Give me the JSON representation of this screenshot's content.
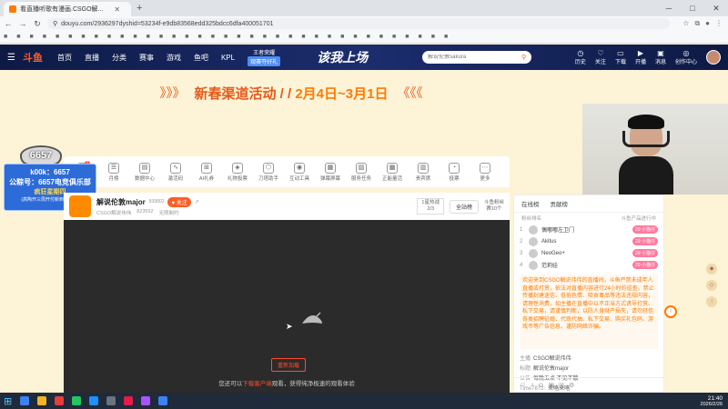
{
  "browser": {
    "tab_title": "看直播听歌有漫画.CSGO解...",
    "url": "douyu.com/2936297dyshid=53234f-e9db83568edd325bdcc6dfa400051701",
    "bookmarks": [
      "■",
      "■",
      "■",
      "■",
      "■",
      "■",
      "■",
      "■",
      "■",
      "■",
      "■",
      "■",
      "■",
      "■",
      "■",
      "■",
      "■",
      "■",
      "■",
      "■",
      "■",
      "■",
      "■",
      "■",
      "■",
      "■",
      "■",
      "■",
      "■",
      "■",
      "■",
      "■",
      "■",
      "■",
      "■"
    ]
  },
  "header": {
    "logo": "斗鱼",
    "nav": [
      "首页",
      "直播",
      "分类",
      "赛事",
      "游戏",
      "鱼吧",
      "KPL"
    ],
    "kpl_top": "王者荣耀",
    "kpl_badge": "观赛夺好礼",
    "slogan": "该我上场",
    "search_placeholder": "解说伦敦sakura",
    "icons": [
      {
        "glyph": "◷",
        "label": "历史"
      },
      {
        "glyph": "♡",
        "label": "关注"
      },
      {
        "glyph": "▭",
        "label": "下载"
      },
      {
        "glyph": "▶",
        "label": "开播"
      },
      {
        "glyph": "▣",
        "label": "消息"
      },
      {
        "glyph": "◎",
        "label": "创作中心"
      }
    ]
  },
  "banner": {
    "left_arrows": "》》》",
    "text": "新春渠道活动 / / ",
    "dates": "2月4日~3月1日",
    "right_arrows": "《《《"
  },
  "overlay": {
    "badge": "6657",
    "line1": "k00k：6657",
    "line2": "公粽号：6657电竞俱乐部",
    "line3": "疯狂星期四",
    "line4": "(高陶开三周开付新到和刚开)"
  },
  "toolbar": [
    {
      "glyph": "◆",
      "label": "直播开关",
      "badge": "1"
    },
    {
      "glyph": "☰",
      "label": "月榜"
    },
    {
      "glyph": "▤",
      "label": "数据中心"
    },
    {
      "glyph": "∿",
      "label": "激活码"
    },
    {
      "glyph": "⊞",
      "label": "AI礼券"
    },
    {
      "glyph": "◈",
      "label": "礼物投票"
    },
    {
      "glyph": "⬡",
      "label": "刀塔助手"
    },
    {
      "glyph": "◉",
      "label": "互动工具"
    },
    {
      "glyph": "▦",
      "label": "弹幕屏幕"
    },
    {
      "glyph": "▨",
      "label": "服务任务"
    },
    {
      "glyph": "▩",
      "label": "正能量活"
    },
    {
      "glyph": "▥",
      "label": "贵宾席"
    },
    {
      "glyph": "◔",
      "label": "投票"
    },
    {
      "glyph": "⋯",
      "label": "更多"
    }
  ],
  "streamer": {
    "name": "解说伦敦major",
    "id": "839802",
    "follow_label": "关注",
    "category": "CSGO解说伟伟",
    "viewers": "823552",
    "status": "无限制约",
    "rank_label": "1星热战",
    "rank_value": "2/3",
    "all_label": "全站榜",
    "fans_label": "斗鱼粉丝",
    "fans_value": "赛10个"
  },
  "video": {
    "play_label": "重新加载",
    "hint_prefix": "您还可以",
    "hint_link": "下载客户端",
    "hint_suffix": "观看，获得纯净极速的观看体验"
  },
  "rpanel": {
    "tabs": [
      "在线榜",
      "贡献榜"
    ],
    "sub_left": "粉丝排名",
    "sub_right": "斗鱼产品进行中",
    "ranks": [
      {
        "num": "1",
        "name": "偶嘟嘟左卫门",
        "tag": "29 小猫仔"
      },
      {
        "num": "2",
        "name": "Akitus",
        "tag": "29 小猫仔"
      },
      {
        "num": "3",
        "name": "NeoGeo+",
        "tag": "29 小猫仔"
      },
      {
        "num": "4",
        "name": "范莉娃",
        "tag": "29 小猫仔"
      }
    ],
    "notice": "欢迎来到CSGO解说伟伟的直播间，斗鱼严禁未成年人直播或打赏，依法对直播内容进行24小时的巡查，禁止传播封建迷信、低俗色情、吸食毒品等违法违规内容，请理性消费，如主播在直播中以不正当方式诱导打赏、私下交易，请谨慎判断，以防人身财产损失，请勿轻信各类招聘征婚、代练代抽、私下交易、购买礼包码、游戏币等广告信息，谨防网络诈骗。",
    "messages": [
      {
        "label": "主播",
        "text": "CSGO解说伟伟"
      },
      {
        "label": "标题",
        "text": "解说伦敦major"
      },
      {
        "label": "公告",
        "text": "每晚五点 不见不散"
      },
      {
        "label": "Time7872:",
        "text": "来咯来咯"
      }
    ],
    "input_icons": [
      "☺",
      "♪",
      "⊙",
      "▣",
      "✉",
      "⚙"
    ]
  },
  "taskbar": {
    "time": "21:40",
    "date": "2026/2/26",
    "icons": [
      "#3b82f6",
      "#f0b429",
      "#e53e3e",
      "#22c55e",
      "#1e90ff",
      "#6b7280",
      "#e11d48",
      "#a855f7",
      "#3b82f6"
    ]
  }
}
